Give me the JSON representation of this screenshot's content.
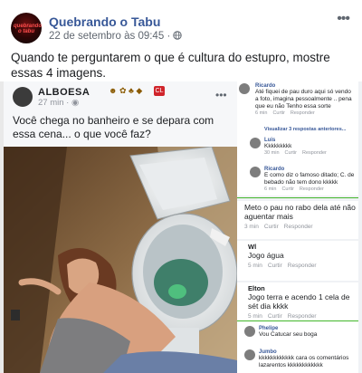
{
  "post": {
    "page_name": "Quebrando o Tabu",
    "avatar_text": "quebrando o tabu",
    "date": "22 de setembro às 09:45",
    "separator": "·",
    "privacy_icon": "globe-icon",
    "caption": "Quando te perguntarem o que é cultura do estupro, mostre essas 4 imagens."
  },
  "inner_post": {
    "author": "ALBOESA",
    "time": "27 min",
    "badge": "CL",
    "text": "Você chega no banheiro e se depara com essa cena... o que você faz?"
  },
  "comments": {
    "thread": [
      {
        "name": "Ricardo",
        "text": "Até fiquei de pau duro aqui só vendo a foto, imagina pessoalmente .. pena que eu não Tenho essa sorte",
        "time": "6 min",
        "like": "Curtir",
        "reply": "Responder"
      },
      {
        "name": "Luis",
        "text": "Kkkkkkkkk",
        "time": "30 min",
        "like": "Curtir",
        "reply": "Responder"
      },
      {
        "name": "Ricardo",
        "text": "E como diz o famoso ditado; C. de bebado não tem dono kkkkk",
        "time": "6 min",
        "like": "Curtir",
        "reply": "Responder"
      }
    ],
    "view_replies": "Visualizar 3 respostas anteriores...",
    "big": [
      {
        "name": "",
        "text": "Meto o pau no rabo dela até não aguentar mais",
        "time": "3 min",
        "like": "Curtir",
        "reply": "Responder"
      },
      {
        "name": "Wl",
        "text": "Jogo água",
        "time": "5 min",
        "like": "Curtir",
        "reply": "Responder"
      },
      {
        "name": "Elton",
        "text": "Jogo terra e acendo 1 cela de sét dia kkkk",
        "time": "5 min",
        "like": "Curtir",
        "reply": "Responder"
      }
    ],
    "bottom": [
      {
        "name": "Phelipe",
        "text": "Vou Catucar seu boga"
      },
      {
        "name": "Jumbo",
        "text": "kkkkkkkkkkkk cara os comentários lazarentos kkkkkkkkkkkk"
      }
    ]
  },
  "colors": {
    "link": "#385898",
    "accent_divider": "#42b72a"
  }
}
